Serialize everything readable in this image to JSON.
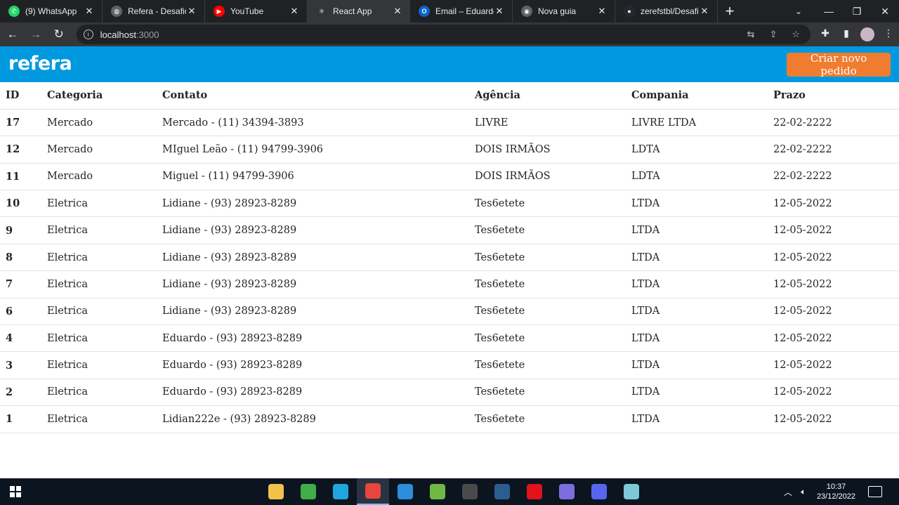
{
  "browser": {
    "tabs": [
      {
        "title": "(9) WhatsApp",
        "favicon": "whatsapp-icon",
        "color": "#25d366",
        "glyph": "✆",
        "active": false
      },
      {
        "title": "Refera - Desafio F",
        "favicon": "globe-icon",
        "color": "#5f6368",
        "glyph": "◍",
        "active": false
      },
      {
        "title": "YouTube",
        "favicon": "youtube-icon",
        "color": "#ff0000",
        "glyph": "▶",
        "active": false
      },
      {
        "title": "React App",
        "favicon": "react-icon",
        "color": "#35363a",
        "glyph": "⚛",
        "active": true
      },
      {
        "title": "Email – Eduardo",
        "favicon": "outlook-icon",
        "color": "#0a64c5",
        "glyph": "O",
        "active": false
      },
      {
        "title": "Nova guia",
        "favicon": "chrome-icon",
        "color": "#5f6368",
        "glyph": "◉",
        "active": false
      },
      {
        "title": "zerefstbl/Desafio",
        "favicon": "github-icon",
        "color": "#24292f",
        "glyph": "●",
        "active": false
      }
    ],
    "url_host": "localhost",
    "url_port": ":3000"
  },
  "app": {
    "logo": "refera",
    "create_button": "Criar novo pedido",
    "colors": {
      "header": "#0099e0",
      "button": "#f07c2f"
    }
  },
  "table": {
    "headers": [
      "ID",
      "Categoria",
      "Contato",
      "Agência",
      "Compania",
      "Prazo"
    ],
    "rows": [
      [
        "17",
        "Mercado",
        "Mercado - (11) 34394-3893",
        "LIVRE",
        "LIVRE LTDA",
        "22-02-2222"
      ],
      [
        "12",
        "Mercado",
        "MIguel Leão - (11) 94799-3906",
        "DOIS IRMÃOS",
        "LDTA",
        "22-02-2222"
      ],
      [
        "11",
        "Mercado",
        "Miguel - (11) 94799-3906",
        "DOIS IRMÃOS",
        "LDTA",
        "22-02-2222"
      ],
      [
        "10",
        "Eletrica",
        "Lidiane - (93) 28923-8289",
        "Tes6etete",
        "LTDA",
        "12-05-2022"
      ],
      [
        "9",
        "Eletrica",
        "Lidiane - (93) 28923-8289",
        "Tes6etete",
        "LTDA",
        "12-05-2022"
      ],
      [
        "8",
        "Eletrica",
        "Lidiane - (93) 28923-8289",
        "Tes6etete",
        "LTDA",
        "12-05-2022"
      ],
      [
        "7",
        "Eletrica",
        "Lidiane - (93) 28923-8289",
        "Tes6etete",
        "LTDA",
        "12-05-2022"
      ],
      [
        "6",
        "Eletrica",
        "Lidiane - (93) 28923-8289",
        "Tes6etete",
        "LTDA",
        "12-05-2022"
      ],
      [
        "4",
        "Eletrica",
        "Eduardo - (93) 28923-8289",
        "Tes6etete",
        "LTDA",
        "12-05-2022"
      ],
      [
        "3",
        "Eletrica",
        "Eduardo - (93) 28923-8289",
        "Tes6etete",
        "LTDA",
        "12-05-2022"
      ],
      [
        "2",
        "Eletrica",
        "Eduardo - (93) 28923-8289",
        "Tes6etete",
        "LTDA",
        "12-05-2022"
      ],
      [
        "1",
        "Eletrica",
        "Lidian222e - (93) 28923-8289",
        "Tes6etete",
        "LTDA",
        "12-05-2022"
      ]
    ]
  },
  "taskbar": {
    "apps": [
      {
        "name": "file-explorer-icon",
        "color": "#f3c14b",
        "active": false
      },
      {
        "name": "app-green-icon",
        "color": "#3fae49",
        "active": false
      },
      {
        "name": "edge-icon",
        "color": "#1fa5e0",
        "active": false
      },
      {
        "name": "chrome-icon",
        "color": "#e8453c",
        "active": true
      },
      {
        "name": "vscode-icon",
        "color": "#2b8fdc",
        "active": false
      },
      {
        "name": "utorrent-icon",
        "color": "#70b844",
        "active": false
      },
      {
        "name": "terminal-icon",
        "color": "#4a4a4a",
        "active": false
      },
      {
        "name": "app-blue-icon",
        "color": "#2c5d8f",
        "active": false
      },
      {
        "name": "opera-icon",
        "color": "#e0121b",
        "active": false
      },
      {
        "name": "app-orb-icon",
        "color": "#7d6ee0",
        "active": false
      },
      {
        "name": "discord-icon",
        "color": "#5865f2",
        "active": false
      },
      {
        "name": "app-notes-icon",
        "color": "#7cc7d8",
        "active": false
      }
    ],
    "time": "10:37",
    "date": "23/12/2022"
  }
}
